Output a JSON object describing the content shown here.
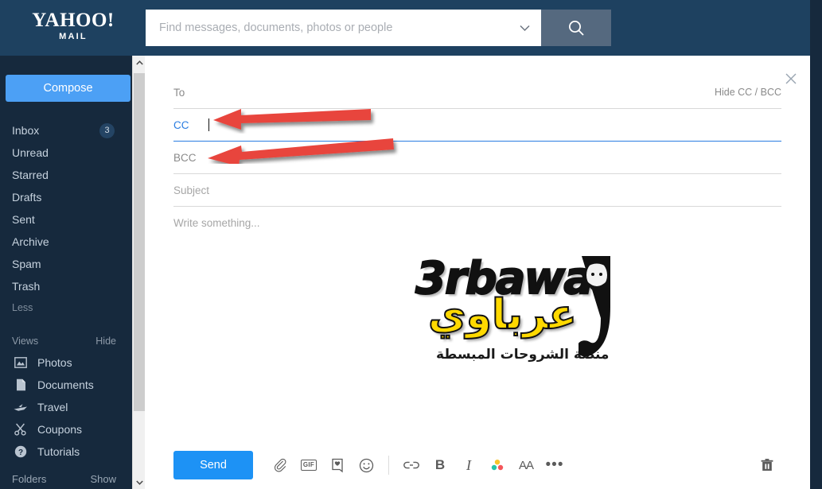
{
  "header": {
    "logo_primary": "YAHOO!",
    "logo_secondary": "MAIL",
    "search_placeholder": "Find messages, documents, photos or people",
    "search_value": "",
    "chevron_icon": "chevron-down-icon",
    "search_icon": "search-icon",
    "bg_color": "#1e4160",
    "search_button_color": "#55697f"
  },
  "sidebar": {
    "compose_label": "Compose",
    "compose_color": "#4ca0f5",
    "bg_color": "#16293d",
    "folders": [
      {
        "label": "Inbox",
        "badge": "3"
      },
      {
        "label": "Unread",
        "badge": ""
      },
      {
        "label": "Starred",
        "badge": ""
      },
      {
        "label": "Drafts",
        "badge": ""
      },
      {
        "label": "Sent",
        "badge": ""
      },
      {
        "label": "Archive",
        "badge": ""
      },
      {
        "label": "Spam",
        "badge": ""
      },
      {
        "label": "Trash",
        "badge": ""
      }
    ],
    "less_label": "Less",
    "views": {
      "title": "Views",
      "action": "Hide",
      "items": [
        {
          "label": "Photos",
          "icon": "photo-icon"
        },
        {
          "label": "Documents",
          "icon": "document-icon"
        },
        {
          "label": "Travel",
          "icon": "airplane-icon"
        },
        {
          "label": "Coupons",
          "icon": "scissors-icon"
        },
        {
          "label": "Tutorials",
          "icon": "question-circle-icon"
        }
      ]
    },
    "folders_section": {
      "title": "Folders",
      "action": "Show"
    },
    "scrollbar": {
      "up_icon": "chevron-up-icon",
      "down_icon": "chevron-down-icon"
    }
  },
  "compose": {
    "close_icon": "close-icon",
    "to": {
      "label": "To",
      "value": "",
      "placeholder": ""
    },
    "hide_cc_bcc": "Hide CC / BCC",
    "cc": {
      "label": "CC",
      "value": "",
      "placeholder": "",
      "focused": true
    },
    "bcc": {
      "label": "BCC",
      "value": "",
      "placeholder": ""
    },
    "subject": {
      "label": "",
      "value": "",
      "placeholder": "Subject"
    },
    "body": {
      "placeholder": "Write something...",
      "value": ""
    },
    "focus_color": "#2a7de1"
  },
  "toolbar": {
    "send_label": "Send",
    "send_color": "#1d92f5",
    "items": [
      {
        "name": "attach-file-icon",
        "glyph": "paperclip"
      },
      {
        "name": "gif-icon",
        "glyph": "GIF"
      },
      {
        "name": "sticker-card-icon",
        "glyph": "card"
      },
      {
        "name": "emoji-icon",
        "glyph": "smiley"
      },
      {
        "name": "insert-link-icon",
        "glyph": "link"
      },
      {
        "name": "bold-icon",
        "glyph": "B"
      },
      {
        "name": "italic-icon",
        "glyph": "I"
      },
      {
        "name": "text-color-icon",
        "glyph": "dots"
      },
      {
        "name": "font-size-icon",
        "glyph": "AA"
      },
      {
        "name": "more-options-icon",
        "glyph": "•••"
      }
    ],
    "delete_icon": "trash-icon"
  },
  "annotations": {
    "arrow_color": "#e8453c",
    "arrows": [
      {
        "name": "cc-arrow",
        "points_to": "CC field"
      },
      {
        "name": "bcc-arrow",
        "points_to": "BCC field"
      }
    ]
  },
  "watermark": {
    "latin": "3rbawa",
    "arabic": "عرباوي",
    "tagline": "منصة الشروحات المبسطة",
    "accent_color": "#ffd900"
  }
}
